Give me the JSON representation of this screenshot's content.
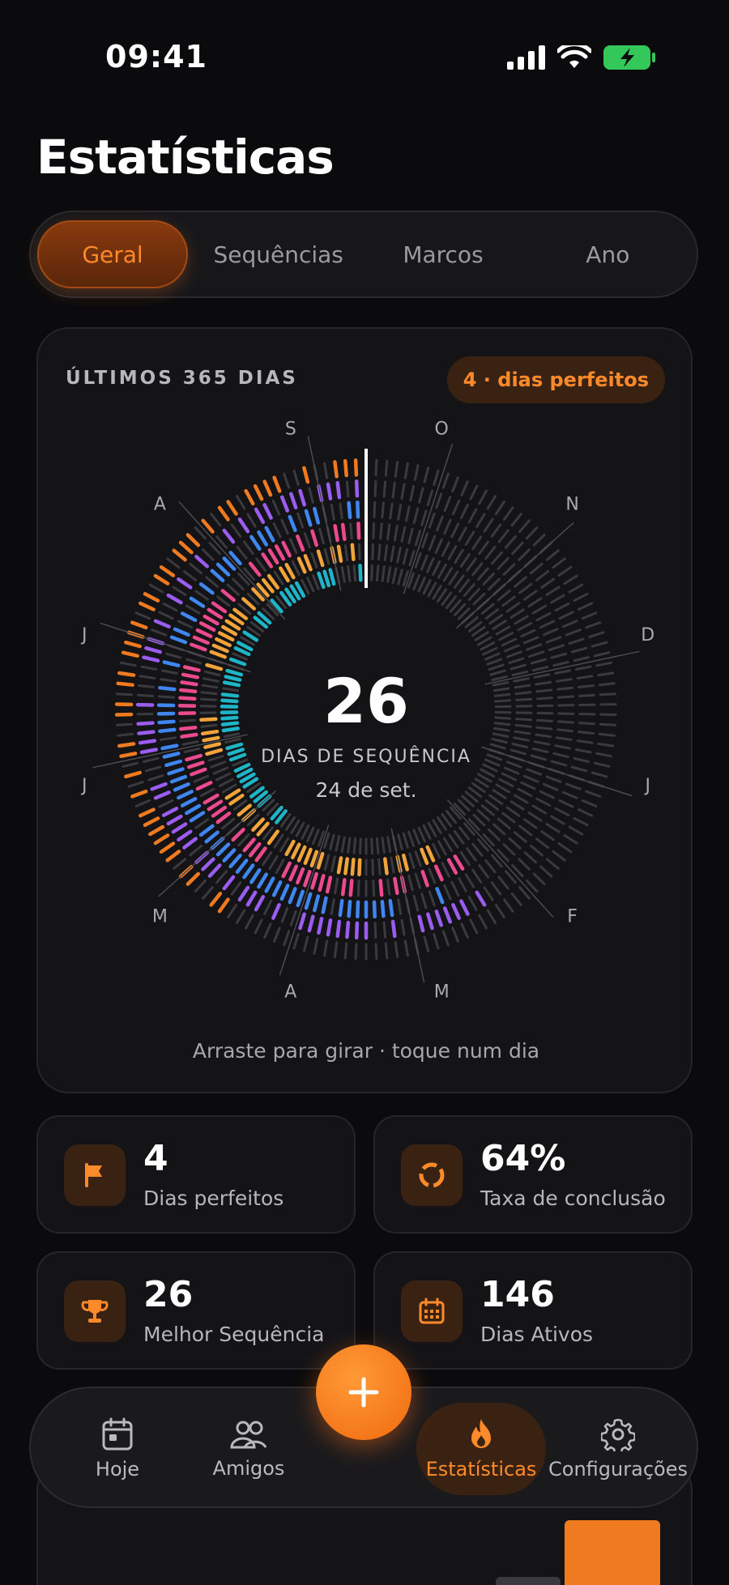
{
  "status": {
    "time": "09:41"
  },
  "page": {
    "title": "Estatísticas"
  },
  "tabs": [
    {
      "label": "Geral",
      "active": true
    },
    {
      "label": "Sequências",
      "active": false
    },
    {
      "label": "Marcos",
      "active": false
    },
    {
      "label": "Ano",
      "active": false
    }
  ],
  "card": {
    "label": "ÚLTIMOS 365 DIAS",
    "badge": "4 · dias perfeitos",
    "streak_value": "26",
    "streak_label": "DIAS DE SEQUÊNCIA",
    "date": "24 de set.",
    "hint": "Arraste para girar · toque num dia",
    "months": [
      "S",
      "O",
      "N",
      "D",
      "J",
      "F",
      "M",
      "A",
      "M",
      "J",
      "J",
      "A"
    ],
    "ring_colors": [
      "#f07a20",
      "#9b5cf0",
      "#3f86f0",
      "#ec4a8f",
      "#f2a33a",
      "#1fb5c9"
    ]
  },
  "stats": [
    {
      "value": "4",
      "label": "Dias perfeitos",
      "icon": "flag-icon"
    },
    {
      "value": "64%",
      "label": "Taxa de conclusão",
      "icon": "progress-ring-icon"
    },
    {
      "value": "26",
      "label": "Melhor Sequência",
      "icon": "trophy-icon"
    },
    {
      "value": "146",
      "label": "Dias Ativos",
      "icon": "calendar-icon"
    }
  ],
  "nav": {
    "today": "Hoje",
    "friends": "Amigos",
    "stats": "Estatísticas",
    "settings": "Configurações"
  },
  "colors": {
    "accent": "#ff8a2a",
    "background": "#0b0b0d"
  }
}
